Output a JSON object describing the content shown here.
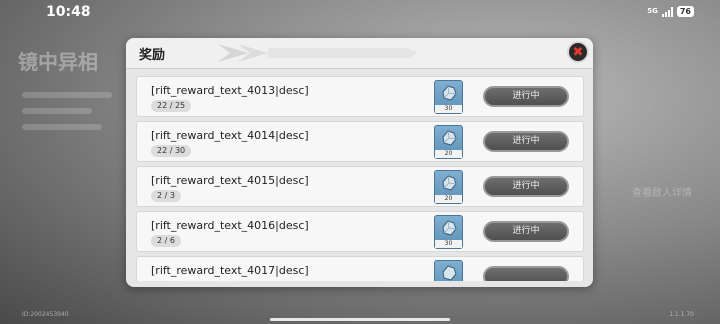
{
  "status_bar": {
    "time": "10:48",
    "network": "5G",
    "battery": "76"
  },
  "background": {
    "title": "镜中异相",
    "right_text": "查看敌人详情",
    "bottom_left": "ID:2002453940",
    "bottom_right": "1.1.1.70"
  },
  "panel": {
    "title": "奖励",
    "close_label": "✖"
  },
  "rewards": [
    {
      "desc": "[rift_reward_text_4013|desc]",
      "progress": "22 / 25",
      "item_qty": "30",
      "status": "进行中"
    },
    {
      "desc": "[rift_reward_text_4014|desc]",
      "progress": "22 / 30",
      "item_qty": "20",
      "status": "进行中"
    },
    {
      "desc": "[rift_reward_text_4015|desc]",
      "progress": "2 / 3",
      "item_qty": "20",
      "status": "进行中"
    },
    {
      "desc": "[rift_reward_text_4016|desc]",
      "progress": "2 / 6",
      "item_qty": "30",
      "status": "进行中"
    },
    {
      "desc": "[rift_reward_text_4017|desc]",
      "progress": "",
      "item_qty": "",
      "status": ""
    }
  ],
  "colors": {
    "accent_close": "#e23a2e",
    "panel_bg": "#e6e6e6",
    "item_bg": "#6f9fc4"
  },
  "icons": {
    "item": "crystal-ore-icon",
    "close": "close-icon"
  }
}
